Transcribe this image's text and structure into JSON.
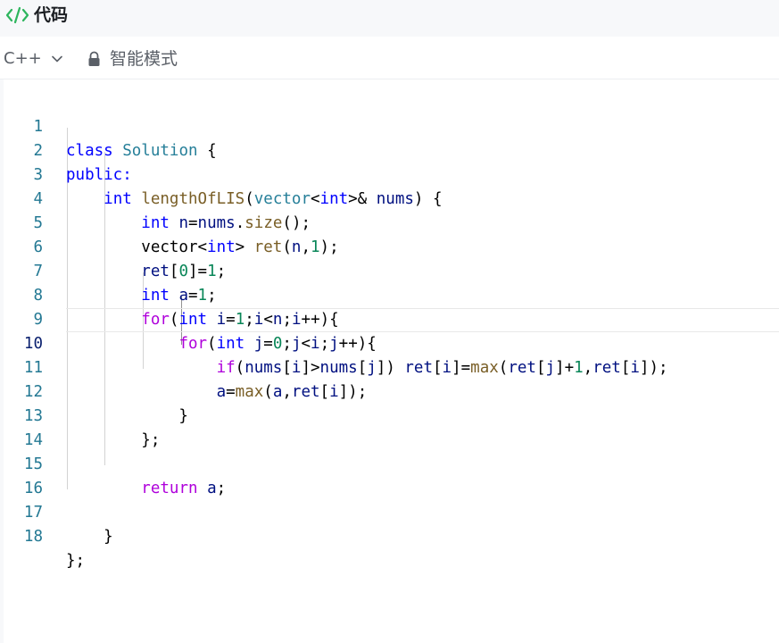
{
  "header": {
    "title": "代码"
  },
  "toolbar": {
    "language": "C++",
    "mode": "智能模式"
  },
  "editor": {
    "active_line": 10,
    "lines": [
      {
        "n": "1",
        "text": "class Solution {"
      },
      {
        "n": "2",
        "text": "public:"
      },
      {
        "n": "3",
        "text": "    int lengthOfLIS(vector<int>& nums) {"
      },
      {
        "n": "4",
        "text": "        int n=nums.size();"
      },
      {
        "n": "5",
        "text": "        vector<int> ret(n,1);"
      },
      {
        "n": "6",
        "text": "        ret[0]=1;"
      },
      {
        "n": "7",
        "text": "        int a=1;"
      },
      {
        "n": "8",
        "text": "        for(int i=1;i<n;i++){"
      },
      {
        "n": "9",
        "text": "            for(int j=0;j<i;j++){"
      },
      {
        "n": "10",
        "text": "                if(nums[i]>nums[j]) ret[i]=max(ret[j]+1,ret[i]);"
      },
      {
        "n": "11",
        "text": "                a=max(a,ret[i]);"
      },
      {
        "n": "12",
        "text": "            }"
      },
      {
        "n": "13",
        "text": "        };"
      },
      {
        "n": "14",
        "text": ""
      },
      {
        "n": "15",
        "text": "        return a;"
      },
      {
        "n": "16",
        "text": ""
      },
      {
        "n": "17",
        "text": "    }"
      },
      {
        "n": "18",
        "text": "};"
      }
    ]
  }
}
